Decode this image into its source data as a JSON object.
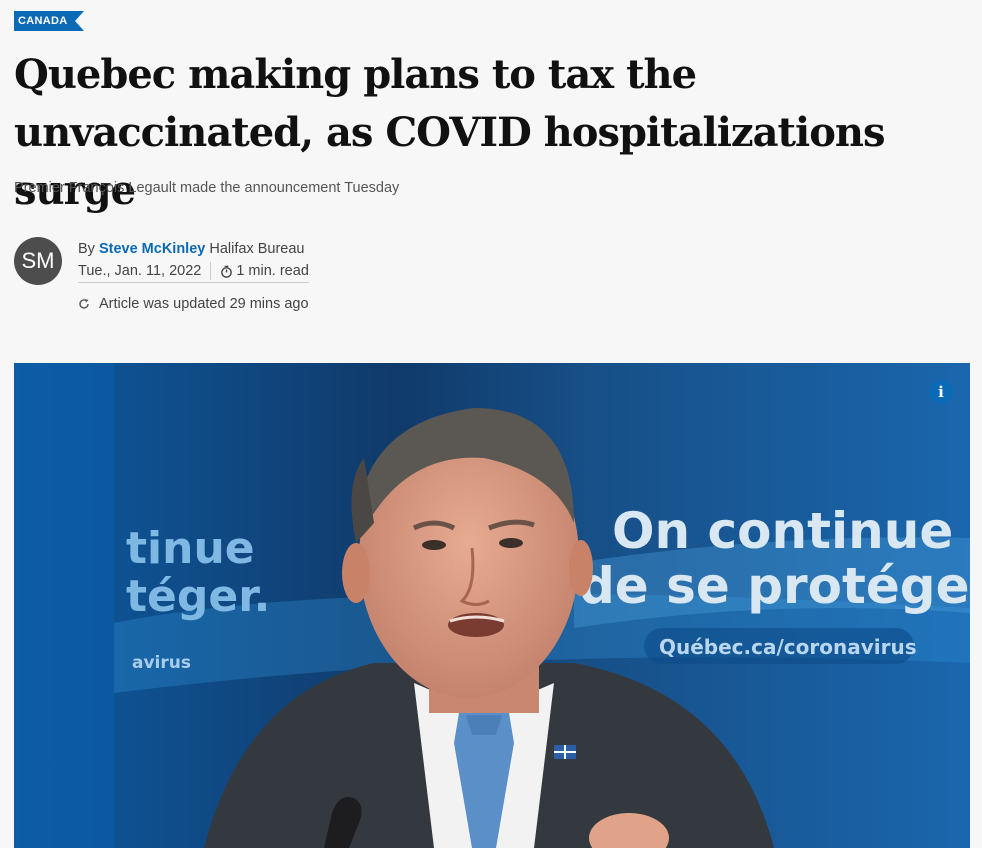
{
  "section": {
    "label": "CANADA"
  },
  "article": {
    "headline": "Quebec making plans to tax the unvaccinated, as COVID hospitalizations surge",
    "subhead": "Premier François Legault made the announcement Tuesday",
    "author": {
      "initials": "SM",
      "prefix": "By",
      "name": "Steve McKinley",
      "bureau": "Halifax Bureau"
    },
    "date": "Tue., Jan. 11, 2022",
    "read_time": "1 min. read",
    "updated": "Article was updated 29 mins ago"
  },
  "hero": {
    "backdrop_left_line1": "tinue",
    "backdrop_left_line2": "téger.",
    "backdrop_left_line3": "avirus",
    "backdrop_right_line1": "On continue",
    "backdrop_right_line2": "de se protéger.",
    "backdrop_url": "Québec.ca/coronavirus",
    "info_label": "i"
  },
  "colors": {
    "accent": "#0a6ab5",
    "headline": "#111111",
    "background": "#f7f7f7"
  },
  "icons": {
    "timer": "stopwatch-icon",
    "updated": "refresh-icon",
    "info": "info-icon"
  }
}
